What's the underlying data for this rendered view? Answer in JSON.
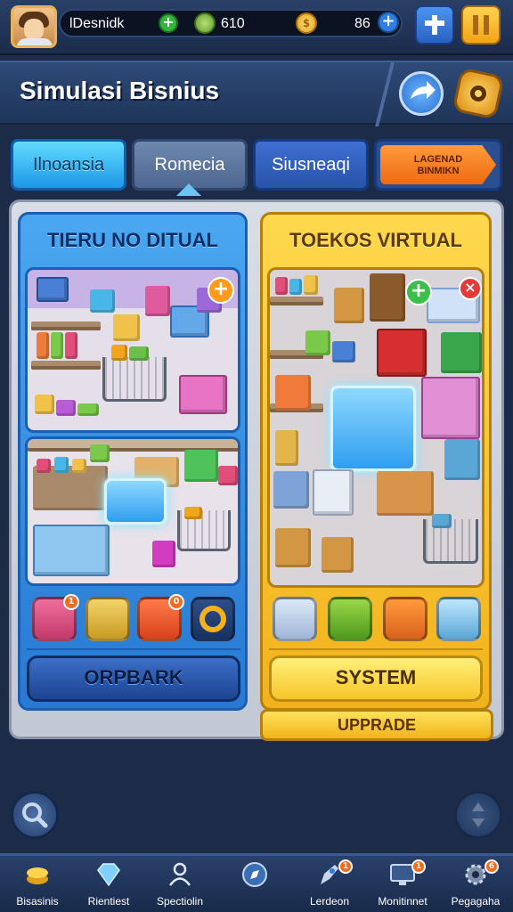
{
  "topbar": {
    "player_name": "lDesnidk",
    "gems_value": "610",
    "gold_value": "86"
  },
  "header": {
    "title": "Simulasi Bisnius"
  },
  "tabs": [
    {
      "label": "Ilnoansia"
    },
    {
      "label": "Romecia"
    },
    {
      "label": "Siusneaqi"
    },
    {
      "label_line1": "LAGENAD",
      "label_line2": "BINMIKN"
    }
  ],
  "cards": {
    "left": {
      "title": "TIERU NO DITUAL",
      "button_label": "ORPBARK"
    },
    "right": {
      "title": "TOEKOS VIRTUAL",
      "button_label": "SYSTEM",
      "upgrade_label": "UPPRADE"
    }
  },
  "bottom_nav": [
    {
      "label": "Bisasinis",
      "icon": "coins-icon"
    },
    {
      "label": "Rientiest",
      "icon": "diamond-icon"
    },
    {
      "label": "Spectiolin",
      "icon": "people-icon"
    },
    {
      "label": "",
      "icon": "compass-icon"
    },
    {
      "label": "Lerdeon",
      "icon": "rocket-icon"
    },
    {
      "label": "Monitinnet",
      "icon": "monitor-icon"
    },
    {
      "label": "Pegagaha",
      "icon": "gear-icon"
    }
  ],
  "colors": {
    "background": "#1c2b47",
    "accent_blue": "#2779d3",
    "accent_yellow": "#f2b21c",
    "accent_orange": "#ee6a12"
  }
}
